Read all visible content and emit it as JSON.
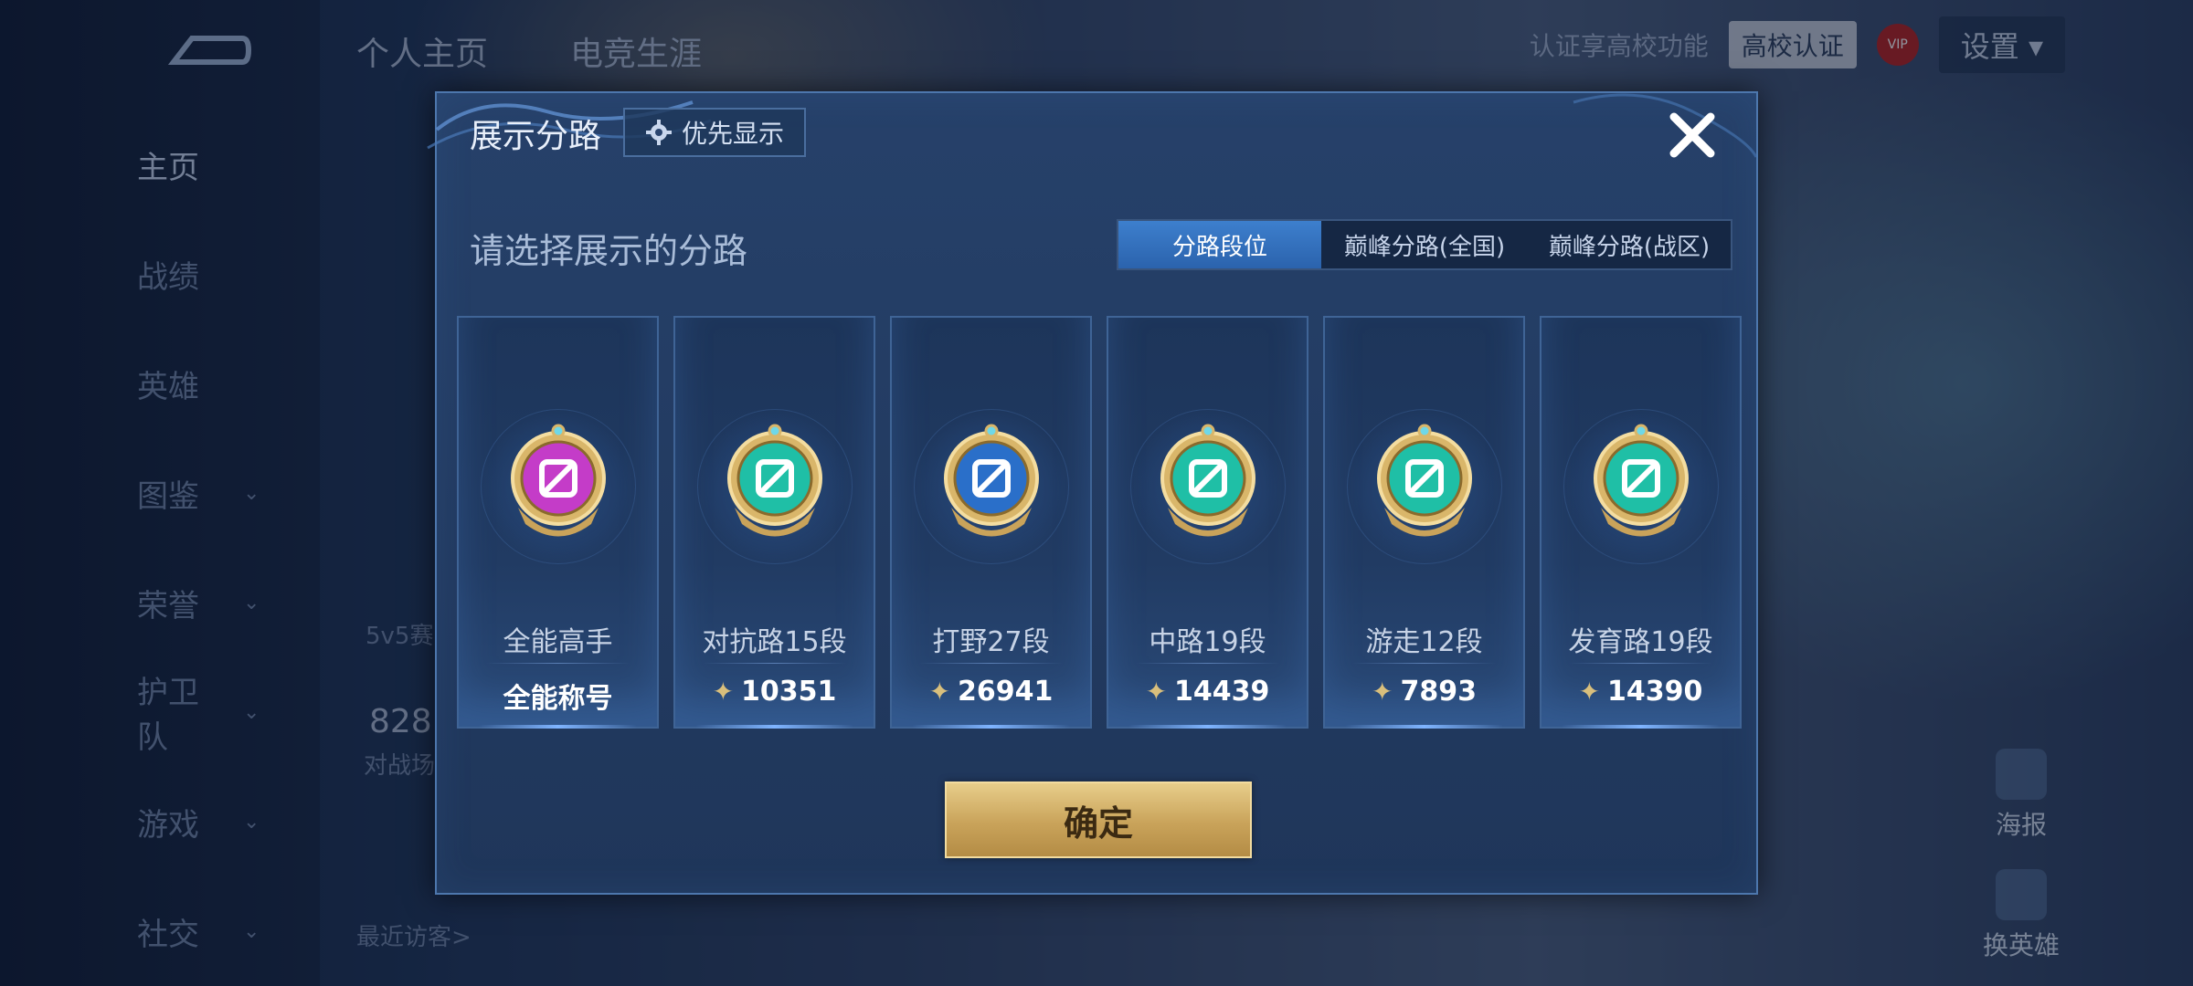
{
  "background": {
    "side_nav": [
      {
        "label": "主页",
        "active": true,
        "has_chevron": false
      },
      {
        "label": "战绩",
        "active": false,
        "has_chevron": false
      },
      {
        "label": "英雄",
        "active": false,
        "has_chevron": false
      },
      {
        "label": "图鉴",
        "active": false,
        "has_chevron": true
      },
      {
        "label": "荣誉",
        "active": false,
        "has_chevron": true
      },
      {
        "label": "护卫队",
        "active": false,
        "has_chevron": true
      },
      {
        "label": "游戏",
        "active": false,
        "has_chevron": true
      },
      {
        "label": "社交",
        "active": false,
        "has_chevron": true
      }
    ],
    "top_tabs": [
      "个人主页",
      "电竞生涯"
    ],
    "cert_hint": "认证享高校功能",
    "cert_button": "高校认证",
    "vip_label": "VIP",
    "settings_label": "设置",
    "left_texts": {
      "mode": "5v5赛",
      "count": "828",
      "battles": "对战场",
      "visitors": "最近访客>"
    },
    "right_buttons": [
      "海报",
      "换英雄"
    ]
  },
  "modal": {
    "title": "展示分路",
    "priority_button": "优先显示",
    "subtitle": "请选择展示的分路",
    "tabs": [
      {
        "label": "分路段位",
        "active": true
      },
      {
        "label": "巅峰分路(全国)",
        "active": false
      },
      {
        "label": "巅峰分路(战区)",
        "active": false
      }
    ],
    "cards": [
      {
        "name": "全能高手",
        "score": "全能称号",
        "show_star": false,
        "badge_color": "#c43cc8"
      },
      {
        "name": "对抗路15段",
        "score": "10351",
        "show_star": true,
        "badge_color": "#1fbfa6"
      },
      {
        "name": "打野27段",
        "score": "26941",
        "show_star": true,
        "badge_color": "#2a6fc9"
      },
      {
        "name": "中路19段",
        "score": "14439",
        "show_star": true,
        "badge_color": "#1fbfa6"
      },
      {
        "name": "游走12段",
        "score": "7893",
        "show_star": true,
        "badge_color": "#1fbfa6"
      },
      {
        "name": "发育路19段",
        "score": "14390",
        "show_star": true,
        "badge_color": "#1fbfa6"
      }
    ],
    "confirm_label": "确定"
  }
}
